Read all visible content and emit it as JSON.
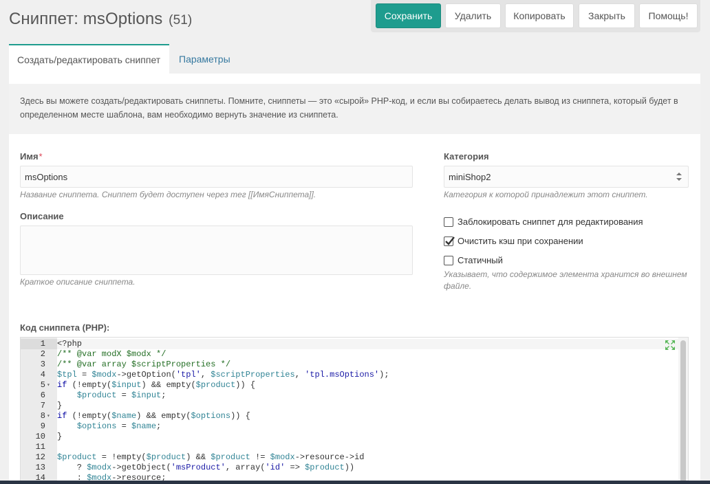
{
  "header": {
    "title": "Сниппет: msOptions",
    "count": "(51)"
  },
  "toolbar": {
    "save": "Сохранить",
    "delete": "Удалить",
    "copy": "Копировать",
    "close": "Закрыть",
    "help": "Помощь!"
  },
  "tabs": [
    {
      "label": "Создать/редактировать сниппет",
      "active": true
    },
    {
      "label": "Параметры",
      "active": false
    }
  ],
  "intro": "Здесь вы можете создать/редактировать сниппеты. Помните, сниппеты — это «сырой» PHP-код, и если вы собираетесь делать вывод из сниппета, который будет в определенном месте шаблона, вам необходимо вернуть значение из сниппета.",
  "form": {
    "name_label": "Имя",
    "name_required": "*",
    "name_value": "msOptions",
    "name_hint": "Название сниппета. Сниппет будет доступен через тег [[ИмяСниппета]].",
    "description_label": "Описание",
    "description_value": "",
    "description_hint": "Краткое описание сниппета.",
    "category_label": "Категория",
    "category_value": "miniShop2",
    "category_hint": "Категория к которой принадлежит этот сниппет.",
    "lock_label": "Заблокировать сниппет для редактирования",
    "lock_checked": false,
    "clear_cache_label": "Очистить кэш при сохранении",
    "clear_cache_checked": true,
    "static_label": "Статичный",
    "static_checked": false,
    "static_hint": "Указывает, что содержимое элемента хранится во внешнем файле.",
    "code_label": "Код сниппета (PHP):"
  },
  "colors": {
    "accent": "#1e9c8e",
    "link": "#35789f"
  },
  "editor": {
    "lines": [
      {
        "n": "1",
        "fold": "",
        "code": "<?php"
      },
      {
        "n": "2",
        "fold": "",
        "code": "/** @var modX $modx */"
      },
      {
        "n": "3",
        "fold": "",
        "code": "/** @var array $scriptProperties */"
      },
      {
        "n": "4",
        "fold": "",
        "code": "$tpl = $modx->getOption('tpl', $scriptProperties, 'tpl.msOptions');"
      },
      {
        "n": "5",
        "fold": "▾",
        "code": "if (!empty($input) && empty($product)) {"
      },
      {
        "n": "6",
        "fold": "",
        "code": "    $product = $input;"
      },
      {
        "n": "7",
        "fold": "",
        "code": "}"
      },
      {
        "n": "8",
        "fold": "▾",
        "code": "if (!empty($name) && empty($options)) {"
      },
      {
        "n": "9",
        "fold": "",
        "code": "    $options = $name;"
      },
      {
        "n": "10",
        "fold": "",
        "code": "}"
      },
      {
        "n": "11",
        "fold": "",
        "code": ""
      },
      {
        "n": "12",
        "fold": "",
        "code": "$product = !empty($product) && $product != $modx->resource->id"
      },
      {
        "n": "13",
        "fold": "",
        "code": "    ? $modx->getObject('msProduct', array('id' => $product))"
      },
      {
        "n": "14",
        "fold": "",
        "code": "    : $modx->resource;"
      }
    ]
  }
}
